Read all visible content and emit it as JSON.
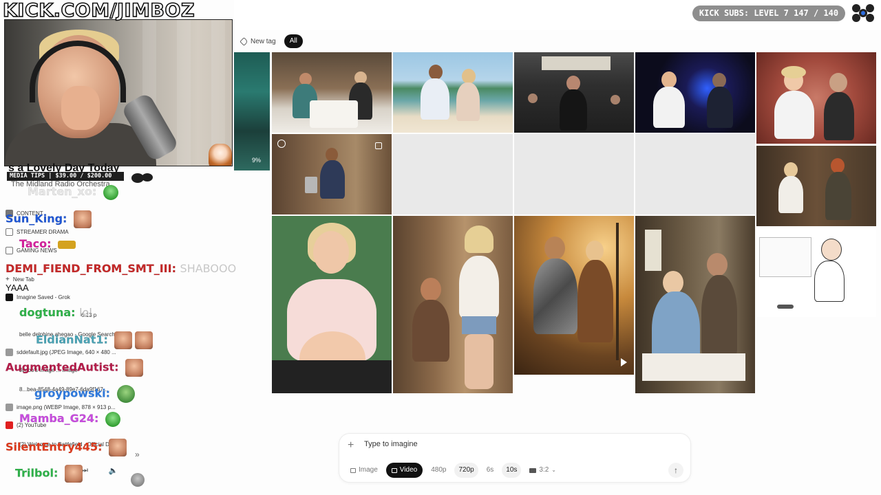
{
  "overlay": {
    "channel_url": "KICK.COM/JIMBOZ",
    "subs_text": "KICK SUBS: LEVEL 7 147 / 140",
    "webcam_percent": "9%",
    "media_tips": "MEDIA TIPS | $39.00 / $200.00",
    "now_playing": {
      "title": "s a Lovely Day Today",
      "artist": "The Midland Radio Orchestra"
    }
  },
  "chat": [
    {
      "user": "Marten_xo:",
      "color": "#e0e0e0",
      "message": ""
    },
    {
      "user": "Sun_King:",
      "color": "#1f57d6",
      "message": ""
    },
    {
      "user": "Taco:",
      "color": "#d61f9d",
      "message": ""
    },
    {
      "user": "DEMI_FIEND_FROM_SMT_III:",
      "color": "#c62828",
      "message": "SHABOOO"
    },
    {
      "user": "dogtuna:",
      "color": "#2fb34a",
      "message": "lol"
    },
    {
      "user": "EldianNat1:",
      "color": "#4aa3b5",
      "message": ""
    },
    {
      "user": "AugmentedAutist:",
      "color": "#b51c4a",
      "message": ""
    },
    {
      "user": "groypowski:",
      "color": "#2f7be0",
      "message": ""
    },
    {
      "user": "Mamba_G24:",
      "color": "#c94be0",
      "message": ""
    },
    {
      "user": "SilentEntry445:",
      "color": "#e03a1c",
      "message": ""
    },
    {
      "user": "Trilbol:",
      "color": "#2fb34a",
      "message": ""
    }
  ],
  "browser_tabs": [
    {
      "label": "CONTENT",
      "top": 0
    },
    {
      "label": "STREAMER DRAMA"
    },
    {
      "label": "GAMING NEWS"
    },
    {
      "label": "New Tab"
    },
    {
      "label": "YAAA"
    },
    {
      "label": "Imagine Saved - Grok"
    },
    {
      "label": "6:13 p"
    },
    {
      "label": "belle delphine ahegao - Google Search"
    },
    {
      "label": "sddefault.jpg (JPEG Image, 640 × 480 ..."
    },
    {
      "label": "Jimbo's Image ... Image"
    },
    {
      "label": "8...bea-8548-4a49-89e7-6da9f167..."
    },
    {
      "label": "image.png (WEBP Image, 878 × 913 p..."
    },
    {
      "label": "(2) YouTube"
    },
    {
      "label": "(2) Welcome to Battlefield - Official Da..."
    }
  ],
  "grok": {
    "tags": {
      "new_tag": "New tag",
      "all": "All"
    },
    "prompt": {
      "placeholder": "Type to imagine",
      "mode_image": "Image",
      "mode_video": "Video",
      "res_480": "480p",
      "res_720": "720p",
      "dur_6": "6s",
      "dur_10": "10s",
      "aspect": "3:2"
    },
    "grid_items": [
      "Couple dining at a long restaurant table",
      "Couple posing on a tropical beach",
      "Man standing in a large crowd with banner",
      "Woman with glowing blue light in dark room",
      "Two people in a cave studio setting",
      "Small man carrying buckets in a barn",
      "Pregnant woman in pink sweater drinking from cup",
      "Short bearded man next to tall woman in denim shorts",
      "Armored knight with warrior woman at sunset",
      "Woman in blue dress sitting beside a man on a bed",
      "Woman and red-haired man in a wooden room",
      "Cartoon drawing of man near whiteboard"
    ]
  },
  "colors": {
    "accent_dark": "#111111",
    "subs_pill": "#8e8e8e"
  },
  "icons": [
    "tag-icon",
    "plus-icon",
    "image-icon",
    "video-icon",
    "aspect-icon",
    "arrow-up-icon",
    "play-icon",
    "brand-logo-icon",
    "mute-icon",
    "skip-icon"
  ]
}
